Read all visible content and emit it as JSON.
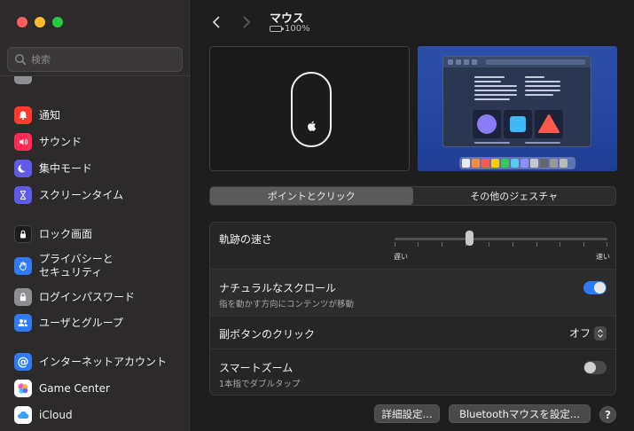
{
  "sidebar": {
    "search_placeholder": "検索",
    "items": [
      {
        "label": "通知",
        "icon": "bell-icon",
        "color": "#ff3b30"
      },
      {
        "label": "サウンド",
        "icon": "speaker-icon",
        "color": "#ff2d55"
      },
      {
        "label": "集中モード",
        "icon": "moon-icon",
        "color": "#5e5ce6"
      },
      {
        "label": "スクリーンタイム",
        "icon": "hourglass-icon",
        "color": "#5e5ce6"
      },
      {
        "label": "ロック画面",
        "icon": "lock-screen-icon",
        "color": "#1c1c1e"
      },
      {
        "label": "プライバシーと\nセキュリティ",
        "icon": "hand-icon",
        "color": "#2f7bf5"
      },
      {
        "label": "ログインパスワード",
        "icon": "padlock-icon",
        "color": "#8e8e93"
      },
      {
        "label": "ユーザとグループ",
        "icon": "users-icon",
        "color": "#2f7bf5"
      },
      {
        "label": "インターネットアカウント",
        "icon": "at-icon",
        "color": "#2f7bf5"
      },
      {
        "label": "Game Center",
        "icon": "game-center-icon",
        "color": "#ffffff"
      },
      {
        "label": "iCloud",
        "icon": "cloud-icon",
        "color": "#ffffff"
      }
    ]
  },
  "header": {
    "title": "マウス",
    "battery": "100%"
  },
  "segmented": {
    "tab1": "ポイントとクリック",
    "tab2": "その他のジェスチャ"
  },
  "settings": {
    "tracking_speed": {
      "label": "軌跡の速さ",
      "slow": "遅い",
      "fast": "速い",
      "value_fraction": 0.35
    },
    "natural_scroll": {
      "label": "ナチュラルなスクロール",
      "sub": "指を動かす方向にコンテンツが移動",
      "on": true
    },
    "secondary_click": {
      "label": "副ボタンのクリック",
      "value": "オフ"
    },
    "smart_zoom": {
      "label": "スマートズーム",
      "sub": "1本指でダブルタップ",
      "on": false
    }
  },
  "buttons": {
    "advanced": "詳細設定...",
    "bluetooth": "Bluetoothマウスを設定...",
    "help": "?"
  },
  "colors": {
    "accent": "#2d7cf6"
  }
}
